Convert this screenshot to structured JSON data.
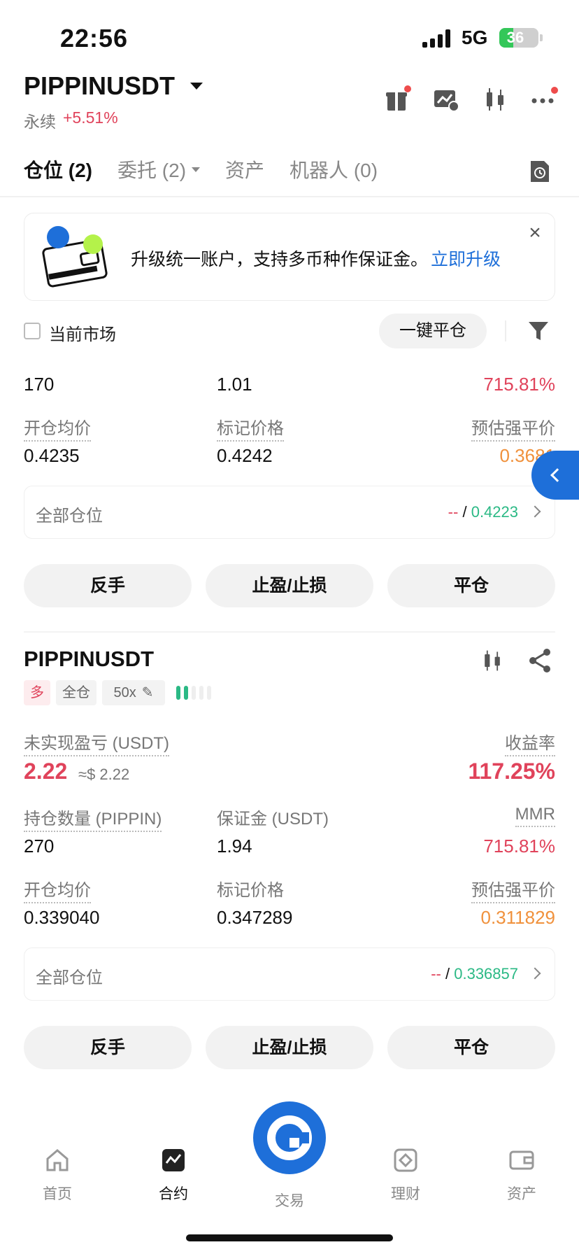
{
  "status": {
    "time": "22:56",
    "network": "5G",
    "battery": "36",
    "battery_level": 0.36
  },
  "header": {
    "pair": "PIPPINUSDT",
    "contract_type": "永续",
    "change": "+5.51%"
  },
  "tabs": [
    {
      "label": "仓位 (2)",
      "active": true
    },
    {
      "label": "委托 (2)",
      "has_dropdown": true
    },
    {
      "label": "资产"
    },
    {
      "label": "机器人 (0)"
    }
  ],
  "banner": {
    "text": "升级统一账户，支持多币种作保证金。",
    "link": "立即升级"
  },
  "filter": {
    "current_market": "当前市场",
    "close_all": "一键平仓"
  },
  "position1": {
    "qty": "170",
    "margin": "1.01",
    "mmr": "715.81%",
    "labels": {
      "entry": "开仓均价",
      "mark": "标记价格",
      "liq": "预估强平价"
    },
    "entry_price": "0.4235",
    "mark_price": "0.4242",
    "liq_price": "0.3681",
    "all_positions": {
      "label": "全部仓位",
      "pnl": "--",
      "slash": "/",
      "price": "0.4223"
    },
    "actions": {
      "reverse": "反手",
      "tpsl": "止盈/止损",
      "close": "平仓"
    }
  },
  "position2": {
    "pair": "PIPPINUSDT",
    "side": "多",
    "margin_mode": "全仓",
    "leverage": "50x",
    "labels": {
      "pnl": "未实现盈亏 (USDT)",
      "roe": "收益率",
      "qty": "持仓数量 (PIPPIN)",
      "margin": "保证金 (USDT)",
      "mmr": "MMR",
      "entry": "开仓均价",
      "mark": "标记价格",
      "liq": "预估强平价"
    },
    "pnl": "2.22",
    "pnl_usd": "≈$ 2.22",
    "roe": "117.25%",
    "qty": "270",
    "margin": "1.94",
    "mmr": "715.81%",
    "entry_price": "0.339040",
    "mark_price": "0.347289",
    "liq_price": "0.311829",
    "all_positions": {
      "label": "全部仓位",
      "pnl": "--",
      "slash": "/",
      "price": "0.336857"
    },
    "actions": {
      "reverse": "反手",
      "tpsl": "止盈/止损",
      "close": "平仓"
    }
  },
  "nav": {
    "home": "首页",
    "futures": "合约",
    "trade": "交易",
    "earn": "理财",
    "assets": "资产"
  },
  "colors": {
    "accent": "#1e6fd9",
    "red": "#e0435b",
    "green": "#2bb985",
    "orange": "#f0913c"
  }
}
